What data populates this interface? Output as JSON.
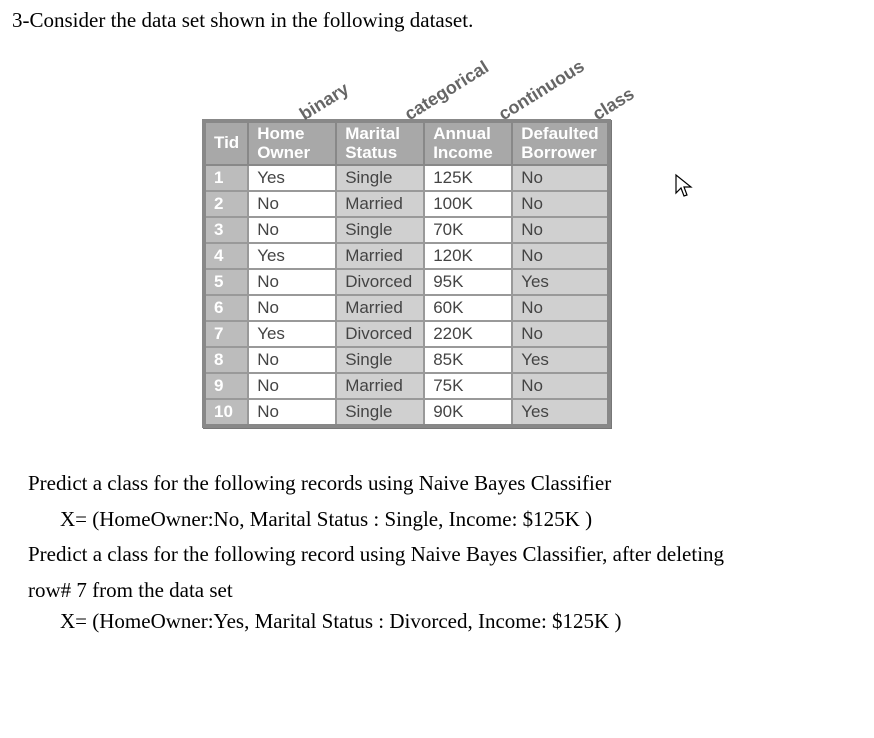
{
  "title_line": "3-Consider the data set shown in the following dataset.",
  "diag_labels": {
    "binary": "binary",
    "categorical": "categorical",
    "continuous": "continuous",
    "class": "class"
  },
  "headers": {
    "tid": "Tid",
    "home_owner_l1": "Home",
    "home_owner_l2": "Owner",
    "marital_l1": "Marital",
    "marital_l2": "Status",
    "income_l1": "Annual",
    "income_l2": "Income",
    "default_l1": "Defaulted",
    "default_l2": "Borrower"
  },
  "rows": [
    {
      "tid": "1",
      "home": "Yes",
      "marital": "Single",
      "income": "125K",
      "default": "No"
    },
    {
      "tid": "2",
      "home": "No",
      "marital": "Married",
      "income": "100K",
      "default": "No"
    },
    {
      "tid": "3",
      "home": "No",
      "marital": "Single",
      "income": "70K",
      "default": "No"
    },
    {
      "tid": "4",
      "home": "Yes",
      "marital": "Married",
      "income": "120K",
      "default": "No"
    },
    {
      "tid": "5",
      "home": "No",
      "marital": "Divorced",
      "income": "95K",
      "default": "Yes"
    },
    {
      "tid": "6",
      "home": "No",
      "marital": "Married",
      "income": "60K",
      "default": "No"
    },
    {
      "tid": "7",
      "home": "Yes",
      "marital": "Divorced",
      "income": "220K",
      "default": "No"
    },
    {
      "tid": "8",
      "home": "No",
      "marital": "Single",
      "income": "85K",
      "default": "Yes"
    },
    {
      "tid": "9",
      "home": "No",
      "marital": "Married",
      "income": "75K",
      "default": "No"
    },
    {
      "tid": "10",
      "home": "No",
      "marital": "Single",
      "income": "90K",
      "default": "Yes"
    }
  ],
  "q1_line1": "Predict a class for the following records using Naive Bayes Classifier",
  "q1_line2": "X= (HomeOwner:No, Marital Status : Single, Income: $125K )",
  "q2_line1": "Predict a class for the following  record using Naive Bayes Classifier, after deleting",
  "q2_line1b": "row# 7 from the data set",
  "q2_line2": "X= (HomeOwner:Yes, Marital Status : Divorced, Income: $125K )",
  "chart_data": {
    "type": "table",
    "title": "Loan default dataset",
    "columns": [
      "Tid",
      "Home Owner",
      "Marital Status",
      "Annual Income",
      "Defaulted Borrower"
    ],
    "column_types": {
      "Tid": "id",
      "Home Owner": "binary",
      "Marital Status": "categorical",
      "Annual Income": "continuous",
      "Defaulted Borrower": "class"
    },
    "records": [
      {
        "Tid": 1,
        "Home Owner": "Yes",
        "Marital Status": "Single",
        "Annual Income": "125K",
        "Defaulted Borrower": "No"
      },
      {
        "Tid": 2,
        "Home Owner": "No",
        "Marital Status": "Married",
        "Annual Income": "100K",
        "Defaulted Borrower": "No"
      },
      {
        "Tid": 3,
        "Home Owner": "No",
        "Marital Status": "Single",
        "Annual Income": "70K",
        "Defaulted Borrower": "No"
      },
      {
        "Tid": 4,
        "Home Owner": "Yes",
        "Marital Status": "Married",
        "Annual Income": "120K",
        "Defaulted Borrower": "No"
      },
      {
        "Tid": 5,
        "Home Owner": "No",
        "Marital Status": "Divorced",
        "Annual Income": "95K",
        "Defaulted Borrower": "Yes"
      },
      {
        "Tid": 6,
        "Home Owner": "No",
        "Marital Status": "Married",
        "Annual Income": "60K",
        "Defaulted Borrower": "No"
      },
      {
        "Tid": 7,
        "Home Owner": "Yes",
        "Marital Status": "Divorced",
        "Annual Income": "220K",
        "Defaulted Borrower": "No"
      },
      {
        "Tid": 8,
        "Home Owner": "No",
        "Marital Status": "Single",
        "Annual Income": "85K",
        "Defaulted Borrower": "Yes"
      },
      {
        "Tid": 9,
        "Home Owner": "No",
        "Marital Status": "Married",
        "Annual Income": "75K",
        "Defaulted Borrower": "No"
      },
      {
        "Tid": 10,
        "Home Owner": "No",
        "Marital Status": "Single",
        "Annual Income": "90K",
        "Defaulted Borrower": "Yes"
      }
    ]
  }
}
